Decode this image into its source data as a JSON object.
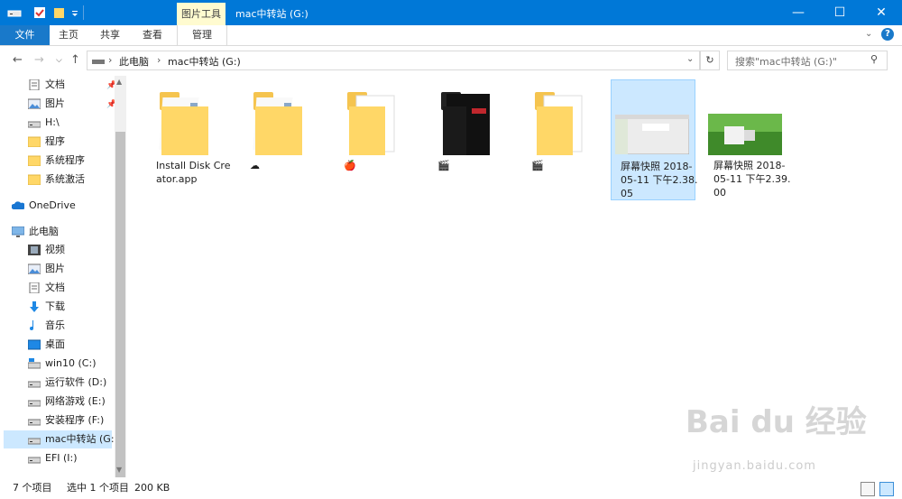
{
  "window": {
    "context_tab": "图片工具",
    "title": "mac中转站 (G:)"
  },
  "ribbon": {
    "tabs": [
      "文件",
      "主页",
      "共享",
      "查看",
      "管理"
    ]
  },
  "address": {
    "crumbs": [
      "此电脑",
      "mac中转站 (G:)"
    ],
    "search_placeholder": "搜索\"mac中转站 (G:)\""
  },
  "nav": {
    "items": [
      {
        "label": "文档",
        "icon": "documents-icon",
        "pinned": true
      },
      {
        "label": "图片",
        "icon": "pictures-icon",
        "pinned": true
      },
      {
        "label": "H:\\",
        "icon": "drive-icon",
        "pinned": false
      },
      {
        "label": "程序",
        "icon": "folder-icon",
        "pinned": false
      },
      {
        "label": "系统程序",
        "icon": "folder-icon",
        "pinned": false
      },
      {
        "label": "系统激活",
        "icon": "folder-icon",
        "pinned": false
      },
      {
        "label": "OneDrive",
        "icon": "onedrive-icon",
        "pinned": false
      },
      {
        "label": "此电脑",
        "icon": "computer-icon",
        "pinned": false
      },
      {
        "label": "视频",
        "icon": "videos-icon",
        "pinned": false
      },
      {
        "label": "图片",
        "icon": "pictures-icon",
        "pinned": false
      },
      {
        "label": "文档",
        "icon": "documents-icon",
        "pinned": false
      },
      {
        "label": "下载",
        "icon": "downloads-icon",
        "pinned": false
      },
      {
        "label": "音乐",
        "icon": "music-icon",
        "pinned": false
      },
      {
        "label": "桌面",
        "icon": "desktop-icon",
        "pinned": false
      },
      {
        "label": "win10 (C:)",
        "icon": "windows-drive-icon",
        "pinned": false
      },
      {
        "label": "运行软件 (D:)",
        "icon": "drive-icon",
        "pinned": false
      },
      {
        "label": "网络游戏 (E:)",
        "icon": "drive-icon",
        "pinned": false
      },
      {
        "label": "安装程序 (F:)",
        "icon": "drive-icon",
        "pinned": false
      },
      {
        "label": "mac中转站 (G:)",
        "icon": "drive-icon",
        "pinned": false,
        "selected": true
      },
      {
        "label": "EFI (I:)",
        "icon": "drive-icon",
        "pinned": false
      }
    ]
  },
  "files": [
    {
      "name": "Install Disk Creator.app",
      "type": "folder-docs"
    },
    {
      "name": "☁",
      "type": "folder-docs"
    },
    {
      "name": "🍎",
      "type": "folder-white"
    },
    {
      "name": "🎬",
      "type": "folder-dark"
    },
    {
      "name": "🎬",
      "type": "folder-white"
    },
    {
      "name": "屏幕快照 2018-05-11 下午2.38.05",
      "type": "screenshot-light",
      "selected": true
    },
    {
      "name": "屏幕快照 2018-05-11 下午2.39.00",
      "type": "screenshot-green"
    }
  ],
  "status": {
    "count": "7 个项目",
    "selection": "选中 1 个项目",
    "size": "200 KB"
  },
  "watermark": {
    "brand": "Bai du 经验",
    "url": "jingyan.baidu.com"
  },
  "colors": {
    "titlebar": "#0078d7",
    "file_tab": "#1979ca",
    "selection": "#cce8ff",
    "folder": "#ffd767"
  }
}
